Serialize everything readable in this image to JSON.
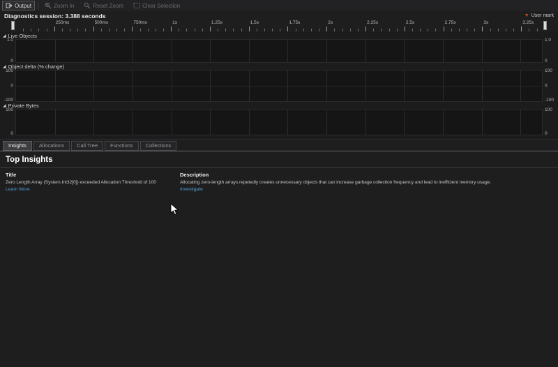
{
  "toolbar": {
    "output_label": "Output",
    "zoom_in_label": "Zoom In",
    "reset_zoom_label": "Reset Zoom",
    "clear_selection_label": "Clear Selection"
  },
  "session": {
    "label": "Diagnostics session: 3.388 seconds",
    "user_mark_label": "User mark"
  },
  "ruler": {
    "total_seconds": 3.388,
    "minor_tick_seconds": 0.05,
    "major_tick_seconds": 0.25,
    "tick_labels": [
      "250ms",
      "500ms",
      "750ms",
      "1s",
      "1.25s",
      "1.5s",
      "1.75s",
      "2s",
      "2.25s",
      "2.5s",
      "2.75s",
      "3s",
      "3.25s"
    ]
  },
  "charts": [
    {
      "title": "Live Objects",
      "y_left": [
        "1.0",
        "0"
      ],
      "y_right": [
        "1.0",
        "0"
      ]
    },
    {
      "title": "Object delta (% change)",
      "y_left": [
        "100",
        "0",
        "-100"
      ],
      "y_right": [
        "100",
        "0",
        "-100"
      ]
    },
    {
      "title": "Private Bytes",
      "y_left": [
        "100",
        "0"
      ],
      "y_right": [
        "100",
        "0"
      ]
    }
  ],
  "tabs": [
    {
      "label": "Insights",
      "active": true
    },
    {
      "label": "Allocations",
      "active": false
    },
    {
      "label": "Call Tree",
      "active": false
    },
    {
      "label": "Functions",
      "active": false
    },
    {
      "label": "Collections",
      "active": false
    }
  ],
  "insights": {
    "section_title": "Top Insights",
    "columns": {
      "title": "Title",
      "description": "Description"
    },
    "rows": [
      {
        "title": "Zero Length Array (System.Int32[0]) exceeded Allocation Threshold of 100",
        "title_link": "Learn More",
        "description": "Allocating zero-length arrays repetedly creates unnecessary objects that can increase garbage collection frequency and lead to inefficient memory usage.",
        "description_link": "Investigate"
      }
    ]
  },
  "colors": {
    "user_mark": "#c2501e",
    "link": "#4e9fd6"
  }
}
